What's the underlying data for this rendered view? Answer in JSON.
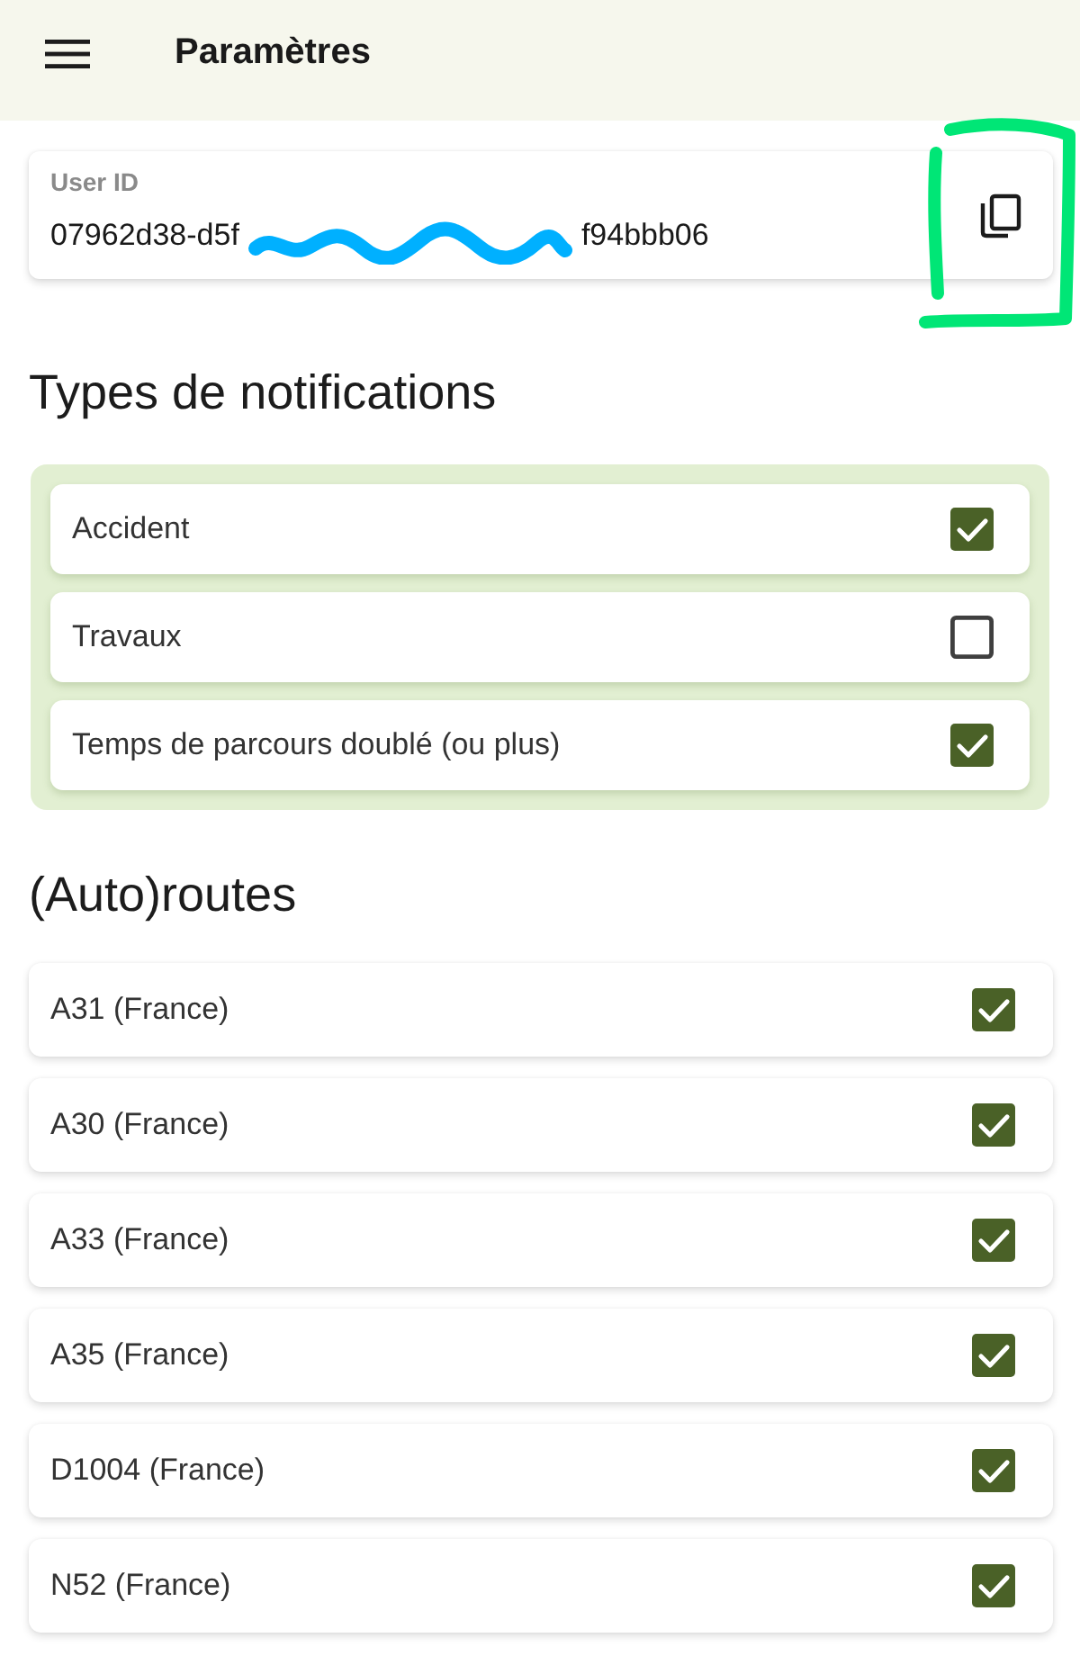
{
  "app_bar": {
    "title": "Paramètres"
  },
  "user_id": {
    "label": "User ID",
    "value_parts": [
      "07962d38-d5f",
      "f94bbb06"
    ]
  },
  "notification_types": {
    "title": "Types de notifications",
    "items": [
      {
        "label": "Accident",
        "checked": true
      },
      {
        "label": "Travaux",
        "checked": false
      },
      {
        "label": "Temps de parcours doublé (ou plus)",
        "checked": true
      }
    ]
  },
  "routes": {
    "title": "(Auto)routes",
    "items": [
      {
        "label": "A31 (France)",
        "checked": true
      },
      {
        "label": "A30 (France)",
        "checked": true
      },
      {
        "label": "A33 (France)",
        "checked": true
      },
      {
        "label": "A35 (France)",
        "checked": true
      },
      {
        "label": "D1004 (France)",
        "checked": true
      },
      {
        "label": "N52 (France)",
        "checked": true
      }
    ]
  },
  "annotations": [
    {
      "kind": "scribble",
      "color": "#00b0ff"
    },
    {
      "kind": "highlight",
      "color": "#00e676"
    }
  ]
}
